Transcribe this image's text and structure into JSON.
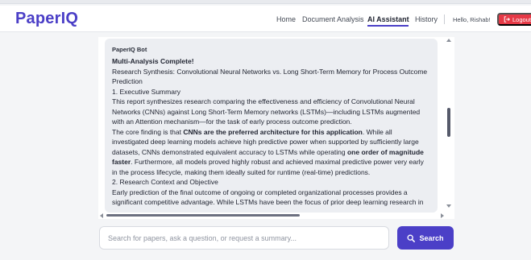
{
  "app": {
    "brand": "PaperIQ"
  },
  "nav": {
    "items": [
      {
        "label": "Home",
        "active": false
      },
      {
        "label": "Document Analysis",
        "active": false
      },
      {
        "label": "AI Assistant",
        "active": true
      },
      {
        "label": "History",
        "active": false
      }
    ],
    "greeting": "Hello, Rishab!",
    "logout_label": "Logout",
    "logout_icon": "logout-icon"
  },
  "chat": {
    "bot_name": "PaperIQ Bot",
    "title": "Multi-Analysis Complete!",
    "lines": [
      [
        {
          "t": "Research Synthesis: Convolutional Neural Networks vs. Long Short-Term Memory for Process Outcome",
          "b": false
        }
      ],
      [
        {
          "t": "Prediction",
          "b": false
        }
      ],
      [
        {
          "t": "1. Executive Summary",
          "b": false
        }
      ],
      [
        {
          "t": "This report synthesizes research comparing the effectiveness and efficiency of Convolutional Neural",
          "b": false
        }
      ],
      [
        {
          "t": "Networks (CNNs) against Long Short-Term Memory networks (LSTMs)—including LSTMs augmented",
          "b": false
        }
      ],
      [
        {
          "t": "with an Attention mechanism—for the task of early process outcome prediction.",
          "b": false
        }
      ],
      [
        {
          "t": "The core finding is that ",
          "b": false
        },
        {
          "t": "CNNs are the preferred architecture for this application",
          "b": true
        },
        {
          "t": ". While all",
          "b": false
        }
      ],
      [
        {
          "t": "investigated deep learning models achieve high predictive power when supported by sufficiently large",
          "b": false
        }
      ],
      [
        {
          "t": "datasets, CNNs demonstrated equivalent accuracy to LSTMs while operating ",
          "b": false
        },
        {
          "t": "one order of magnitude",
          "b": true
        }
      ],
      [
        {
          "t": "faster",
          "b": true
        },
        {
          "t": ". Furthermore, all models proved highly robust and achieved maximal predictive power very early",
          "b": false
        }
      ],
      [
        {
          "t": "in the process lifecycle, making them ideally suited for runtime (real-time) predictions.",
          "b": false
        }
      ],
      [
        {
          "t": "2. Research Context and Objective",
          "b": false
        }
      ],
      [
        {
          "t": "Early prediction of the final outcome of ongoing or completed organizational processes provides a",
          "b": false
        }
      ],
      [
        {
          "t": "significant competitive advantage. While LSTMs have been the focus of prior deep learning research in",
          "b": false
        }
      ]
    ]
  },
  "search": {
    "placeholder": "Search for papers, ask a question, or request a summary...",
    "value": "",
    "button_label": "Search",
    "button_icon": "search-icon"
  },
  "colors": {
    "accent": "#4b3fc7",
    "logout": "#e63946"
  }
}
